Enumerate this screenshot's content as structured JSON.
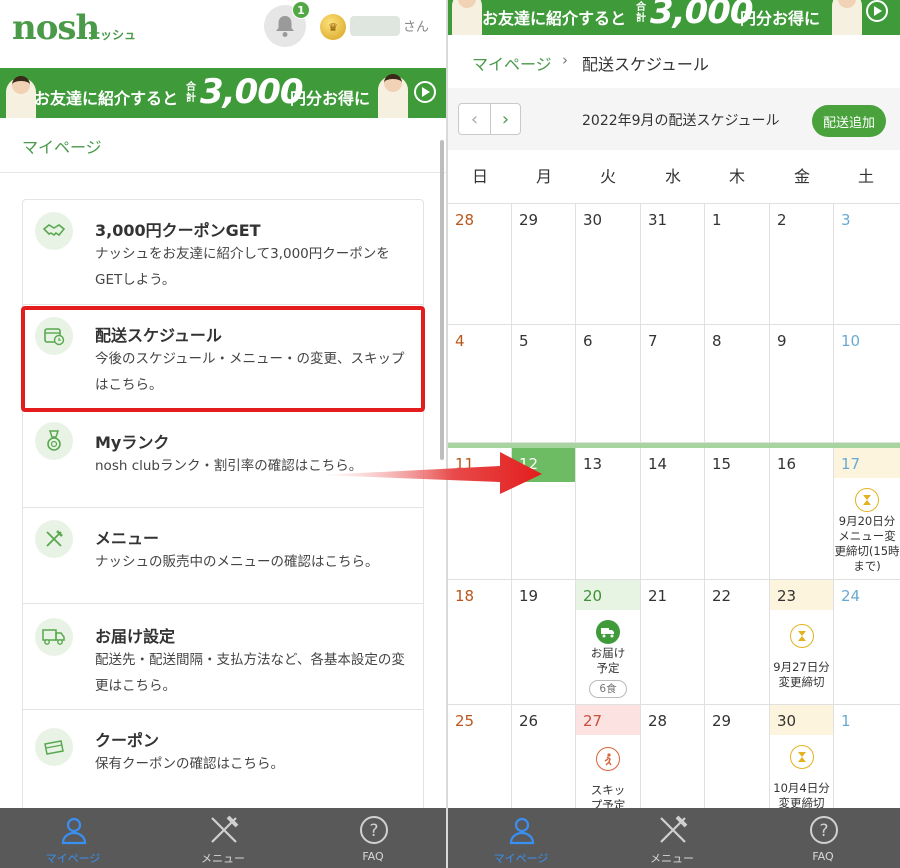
{
  "left": {
    "logo": "nosh",
    "logo_sub": "ナッシュ",
    "notification_count": "1",
    "user_suffix": "さん",
    "banner": {
      "prefix": "お友達に紹介すると",
      "total_label": "合計",
      "amount": "3,000",
      "suffix": "円分お得に"
    },
    "mypage_link": "マイページ",
    "menu_items": [
      {
        "title": "3,000円クーポンGET",
        "desc": "ナッシュをお友達に紹介して3,000円クーポンをGETしよう。",
        "icon": "handshake-icon"
      },
      {
        "title": "配送スケジュール",
        "desc": "今後のスケジュール・メニュー・の変更、スキップはこちら。",
        "icon": "calendar-clock-icon"
      },
      {
        "title": "Myランク",
        "desc": "nosh clubランク・割引率の確認はこちら。",
        "icon": "medal-icon"
      },
      {
        "title": "メニュー",
        "desc": "ナッシュの販売中のメニューの確認はこちら。",
        "icon": "fork-knife-icon"
      },
      {
        "title": "お届け設定",
        "desc": "配送先・配送間隔・支払方法など、各基本設定の変更はこちら。",
        "icon": "truck-icon"
      },
      {
        "title": "クーポン",
        "desc": "保有クーポンの確認はこちら。",
        "icon": "coupon-icon"
      }
    ]
  },
  "nav": {
    "items": [
      {
        "label": "マイページ",
        "icon": "person-icon",
        "active": true
      },
      {
        "label": "メニュー",
        "icon": "fork-knife-icon",
        "active": false
      },
      {
        "label": "FAQ",
        "icon": "question-icon",
        "active": false
      }
    ]
  },
  "right": {
    "banner": {
      "prefix": "お友達に紹介すると",
      "total_label": "合計",
      "amount": "3,000",
      "suffix": "円分お得に"
    },
    "breadcrumb": {
      "home": "マイページ",
      "separator": "›",
      "current": "配送スケジュール"
    },
    "toolbar": {
      "prev": "‹",
      "next": "›",
      "title": "2022年9月の配送スケジュール",
      "add_button": "配送追加"
    },
    "weekdays": [
      "日",
      "月",
      "火",
      "水",
      "木",
      "金",
      "土"
    ],
    "weeks": [
      [
        "28",
        "29",
        "30",
        "31",
        "1",
        "2",
        "3"
      ],
      [
        "4",
        "5",
        "6",
        "7",
        "8",
        "9",
        "10"
      ],
      [
        "11",
        "12",
        "13",
        "14",
        "15",
        "16",
        "17"
      ],
      [
        "18",
        "19",
        "20",
        "21",
        "22",
        "23",
        "24"
      ],
      [
        "25",
        "26",
        "27",
        "28",
        "29",
        "30",
        "1"
      ]
    ],
    "events": {
      "sep17": {
        "text": "9月20日分メニュー変更締切(15時まで)",
        "icon": "hourglass-icon"
      },
      "sep20": {
        "text": "お届け予定",
        "badge": "6食",
        "icon": "delivery-truck-icon"
      },
      "sep23": {
        "text": "9月27日分変更締切",
        "icon": "hourglass-icon"
      },
      "sep27": {
        "text": "スキップ予定",
        "icon": "running-icon"
      },
      "sep30": {
        "text": "10月4日分変更締切",
        "icon": "hourglass-icon"
      }
    }
  },
  "colors": {
    "brand_green": "#3f9a3a",
    "highlight_red": "#e31d1d",
    "nav_active": "#3a8ff2"
  }
}
